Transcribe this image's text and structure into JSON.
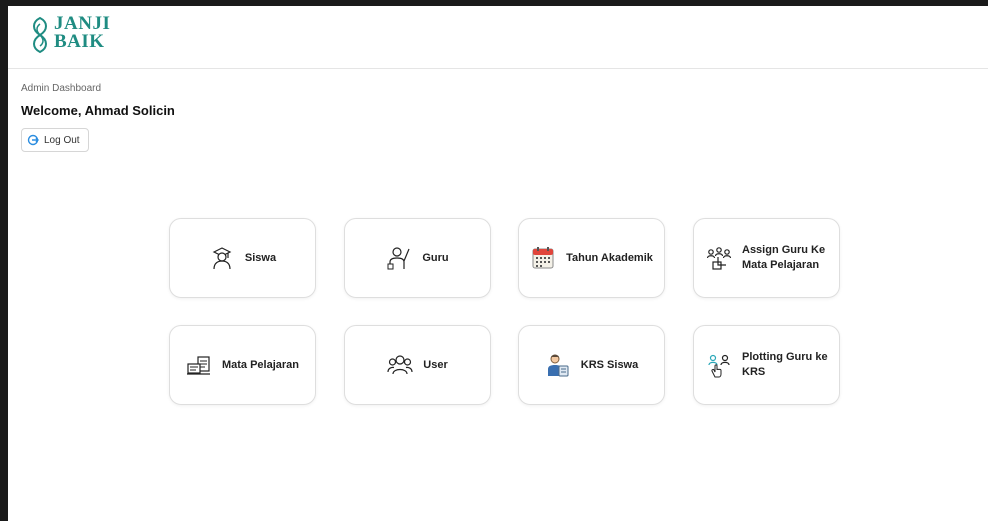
{
  "brand": {
    "line1": "JANJI",
    "line2": "BAIK",
    "color": "#1f8c82"
  },
  "page": {
    "label": "Admin Dashboard",
    "welcome": "Welcome, Ahmad Solicin",
    "logout_label": "Log Out"
  },
  "menu": [
    {
      "label": "Siswa",
      "icon": "student-icon"
    },
    {
      "label": "Guru",
      "icon": "teacher-icon"
    },
    {
      "label": "Tahun Akademik",
      "icon": "calendar-icon"
    },
    {
      "label": "Assign Guru Ke Mata Pelajaran",
      "icon": "assign-teacher-icon"
    },
    {
      "label": "Mata Pelajaran",
      "icon": "subject-icon"
    },
    {
      "label": "User",
      "icon": "users-icon"
    },
    {
      "label": "KRS Siswa",
      "icon": "krs-student-icon"
    },
    {
      "label": "Plotting Guru ke KRS",
      "icon": "plotting-icon"
    }
  ]
}
